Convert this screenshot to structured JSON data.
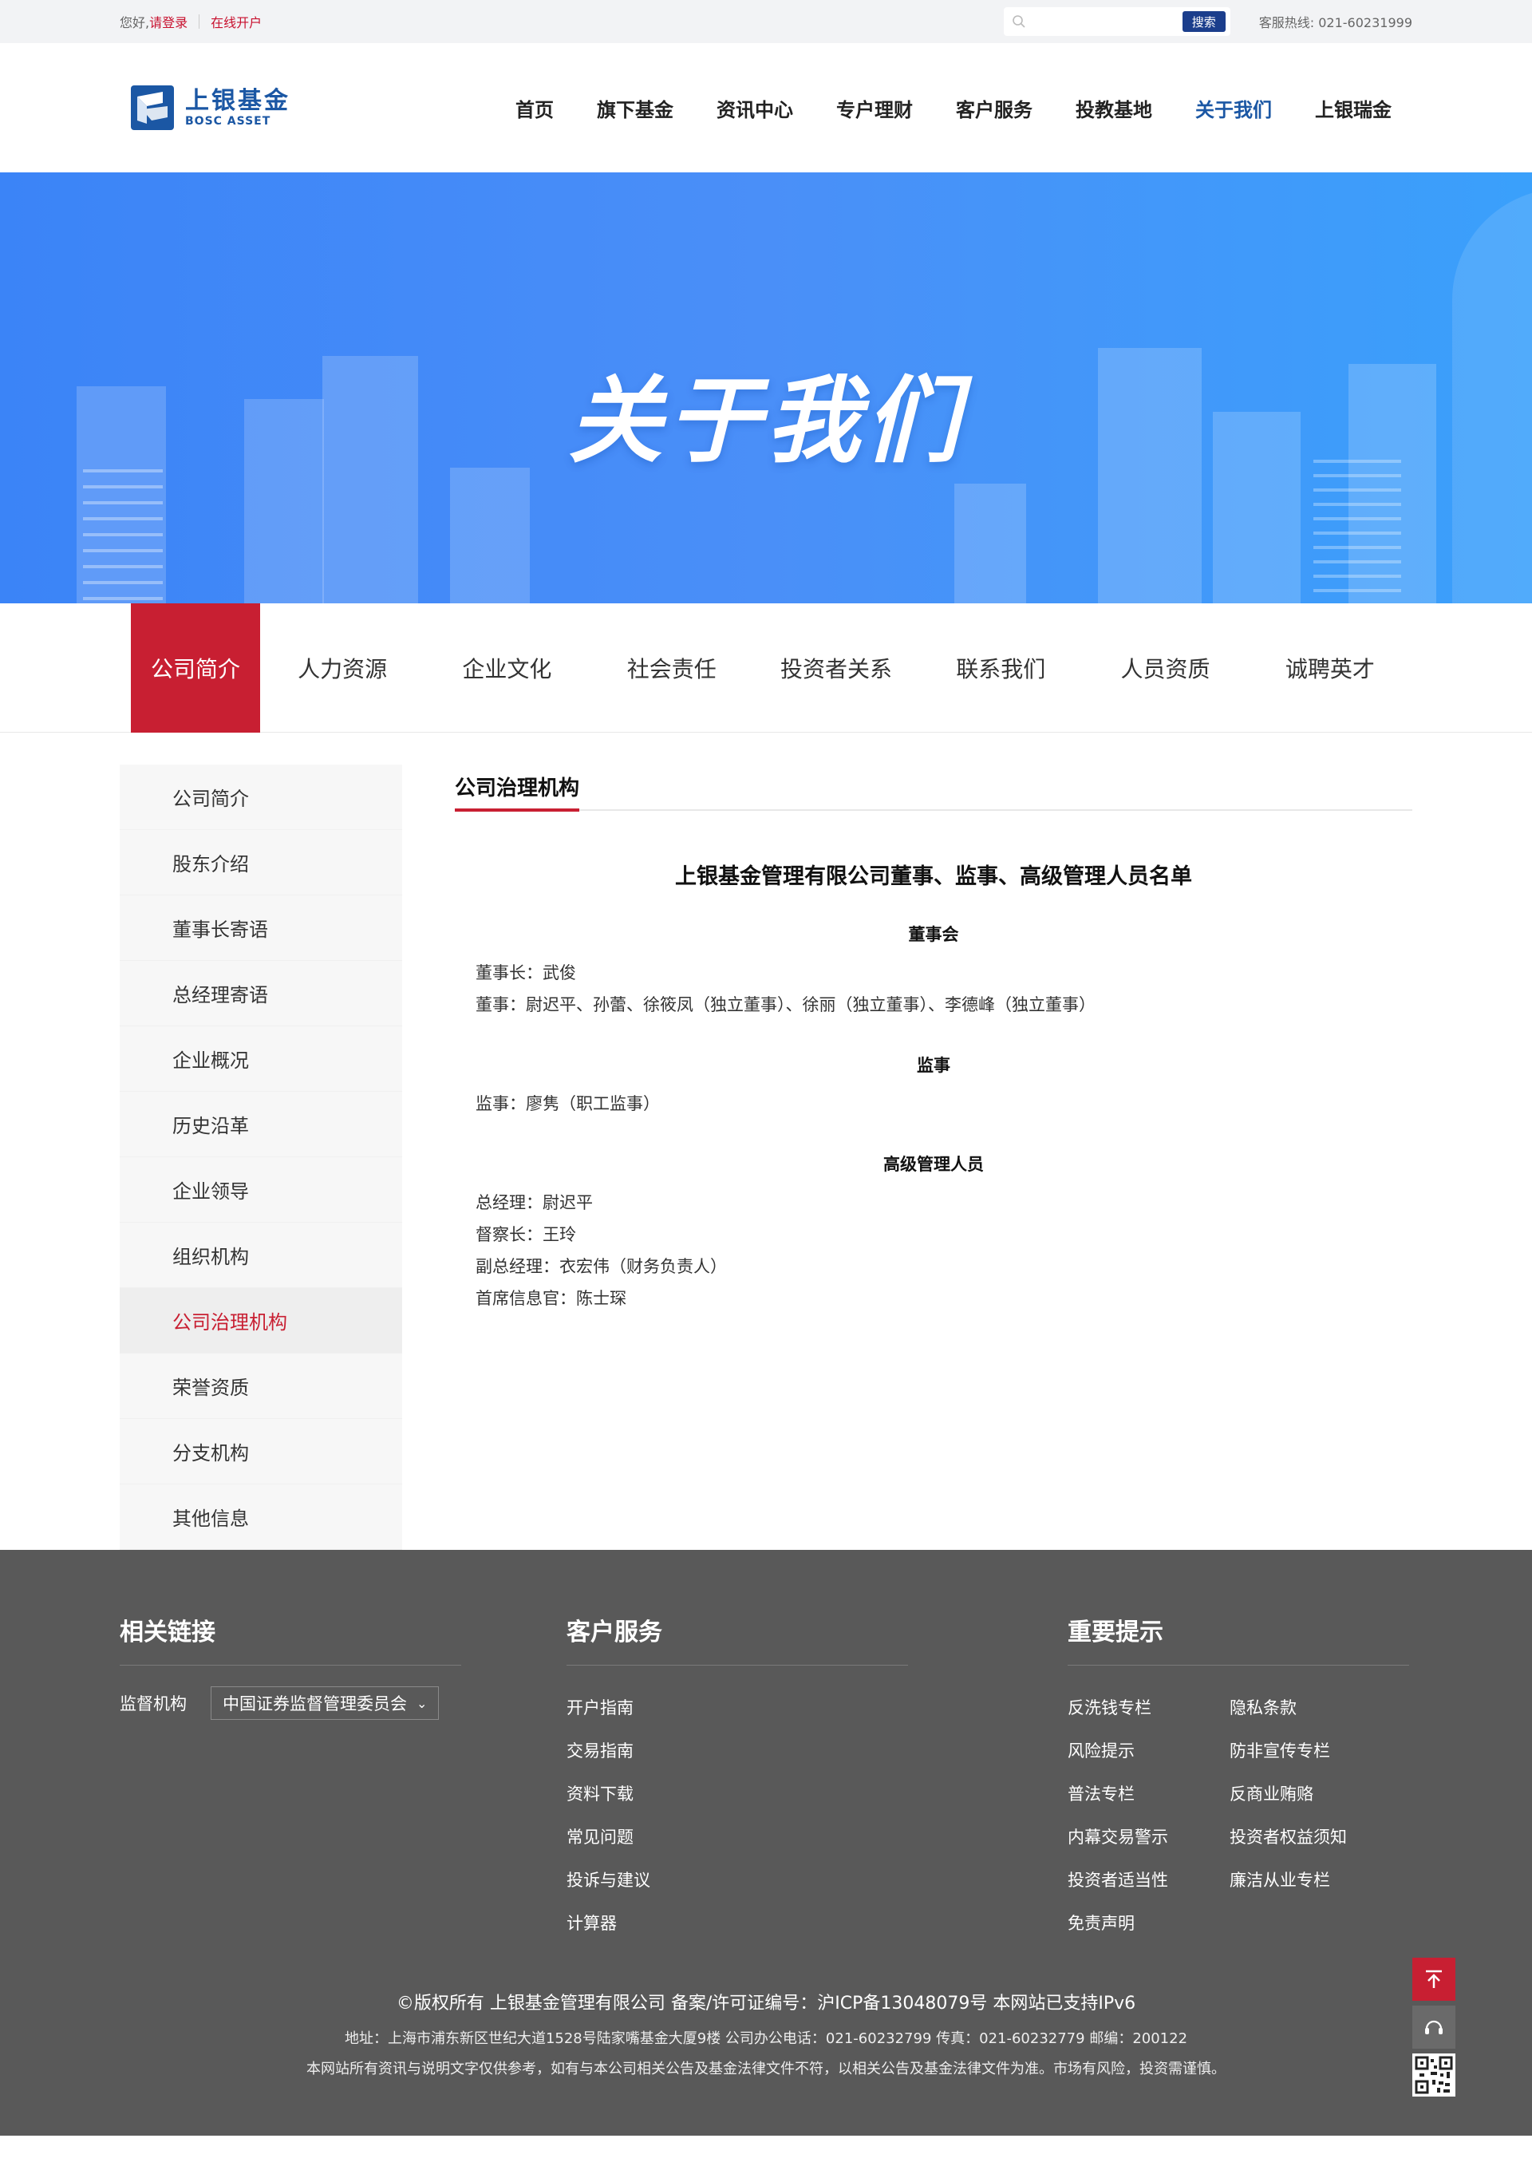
{
  "topbar": {
    "greeting": "您好,",
    "login": "请登录",
    "open_account": "在线开户",
    "search_placeholder": "",
    "search_button": "搜索",
    "hotline": "客服热线: 021-60231999"
  },
  "header": {
    "logo_cn": "上银基金",
    "logo_en": "BOSC ASSET",
    "nav": [
      "首页",
      "旗下基金",
      "资讯中心",
      "专户理财",
      "客户服务",
      "投教基地",
      "关于我们",
      "上银瑞金"
    ],
    "active_nav": "关于我们"
  },
  "banner": {
    "title": "关于我们"
  },
  "subnav": {
    "items": [
      "公司简介",
      "人力资源",
      "企业文化",
      "社会责任",
      "投资者关系",
      "联系我们",
      "人员资质",
      "诚聘英才"
    ],
    "active": "公司简介"
  },
  "sidebar": {
    "items": [
      "公司简介",
      "股东介绍",
      "董事长寄语",
      "总经理寄语",
      "企业概况",
      "历史沿革",
      "企业领导",
      "组织机构",
      "公司治理机构",
      "荣誉资质",
      "分支机构",
      "其他信息"
    ],
    "active": "公司治理机构"
  },
  "content": {
    "heading": "公司治理机构",
    "doc_title": "上银基金管理有限公司董事、监事、高级管理人员名单",
    "board_heading": "董事会",
    "chairman": "董事长：武俊",
    "directors": "董事：尉迟平、孙蕾、徐筱凤（独立董事）、徐丽（独立董事）、李德峰（独立董事）",
    "supervisor_heading": "监事",
    "supervisor": "监事：廖隽（职工监事）",
    "exec_heading": "高级管理人员",
    "gm": "总经理：尉迟平",
    "inspector": "督察长：王玲",
    "deputy_gm": "副总经理：衣宏伟（财务负责人）",
    "cio": "首席信息官：陈士琛"
  },
  "footer": {
    "links_title": "相关链接",
    "supervisor_label": "监督机构",
    "supervisor_select": "中国证券监督管理委员会",
    "service_title": "客户服务",
    "service_items": [
      "开户指南",
      "交易指南",
      "资料下载",
      "常见问题",
      "投诉与建议",
      "计算器"
    ],
    "notice_title": "重要提示",
    "notice_items": [
      "反洗钱专栏",
      "隐私条款",
      "风险提示",
      "防非宣传专栏",
      "普法专栏",
      "反商业贿赂",
      "内幕交易警示",
      "投资者权益须知",
      "投资者适当性",
      "廉洁从业专栏",
      "免责声明"
    ],
    "copyright": "©版权所有  上银基金管理有限公司   备案/许可证编号：沪ICP备13048079号   本网站已支持IPv6",
    "address": "地址：上海市浦东新区世纪大道1528号陆家嘴基金大厦9楼   公司办公电话：021-60232799   传真：021-60232779   邮编：200122",
    "disclaimer": "本网站所有资讯与说明文字仅供参考，如有与本公司相关公告及基金法律文件不符，以相关公告及基金法律文件为准。市场有风险，投资需谨慎。"
  },
  "colors": {
    "brand_blue": "#1b57a4",
    "accent_red": "#c81f32",
    "footer_bg": "#595959"
  }
}
